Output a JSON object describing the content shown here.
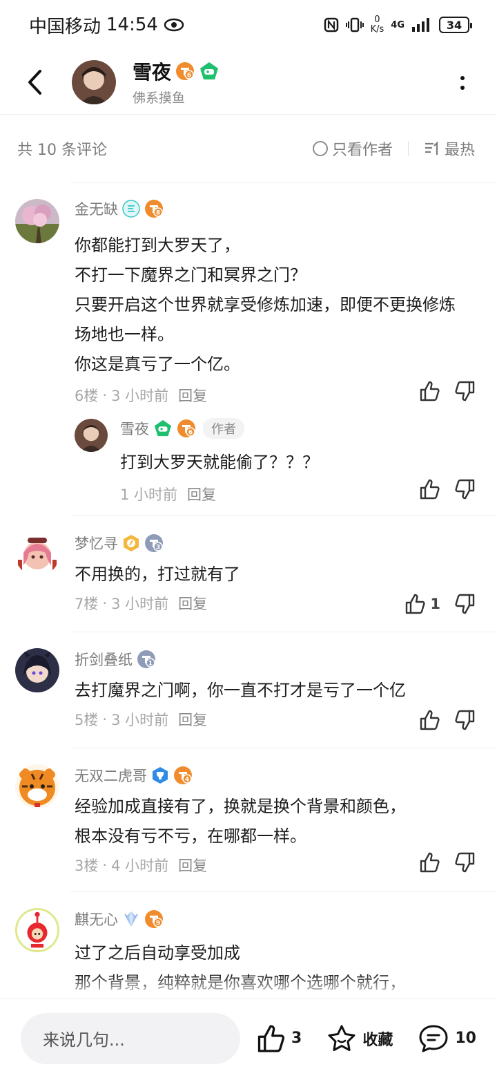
{
  "status": {
    "carrier": "中国移动",
    "time": "14:54",
    "net_speed_value": "0",
    "net_speed_unit": "K/s",
    "signal_label": "4G",
    "battery": "34"
  },
  "header": {
    "name": "雪夜",
    "subtitle": "佛系摸鱼",
    "level": "6"
  },
  "comment_head": {
    "count_label": "共 10 条评论",
    "only_author_label": "只看作者",
    "sort_label": "最热"
  },
  "comments": [
    {
      "name": "金无缺",
      "level": "8",
      "lines": [
        "你都能打到大罗天了，",
        "不打一下魔界之门和冥界之门？",
        "只要开启这个世界就享受修炼加速，即便不更换修炼场地也一样。",
        "你这是真亏了一个亿。"
      ],
      "floor": "6楼",
      "time": "3 小时前",
      "reply_label": "回复",
      "likes": ""
    },
    {
      "name": "梦忆寻",
      "level": "3",
      "lines": [
        "不用换的，打过就有了"
      ],
      "floor": "7楼",
      "time": "3 小时前",
      "reply_label": "回复",
      "likes": "1"
    },
    {
      "name": "折剑叠纸",
      "level": "1",
      "lines": [
        "去打魔界之门啊，你一直不打才是亏了一个亿"
      ],
      "floor": "5楼",
      "time": "3 小时前",
      "reply_label": "回复",
      "likes": ""
    },
    {
      "name": "无双二虎哥",
      "level": "4",
      "lines": [
        "经验加成直接有了，换就是换个背景和颜色，",
        "根本没有亏不亏，在哪都一样。"
      ],
      "floor": "3楼",
      "time": "4 小时前",
      "reply_label": "回复",
      "likes": ""
    },
    {
      "name": "麒无心",
      "level": "9",
      "lines": [
        "过了之后自动享受加成",
        "那个背景，纯粹就是你喜欢哪个选哪个就行，"
      ],
      "floor": "",
      "time": "",
      "reply_label": "",
      "likes": ""
    }
  ],
  "reply": {
    "name": "雪夜",
    "level": "6",
    "author_tag": "作者",
    "text": "打到大罗天就能偷了？？？",
    "time": "1 小时前",
    "reply_label": "回复"
  },
  "bottom": {
    "input_placeholder": "来说几句...",
    "like_count": "3",
    "collect_label": "收藏",
    "comment_count": "10"
  },
  "colors": {
    "level_orange": "#f08c2d",
    "level_gray": "#8e9cb8",
    "vip_green": "#1fbf6e",
    "accent_text": "#1c1c1c"
  }
}
